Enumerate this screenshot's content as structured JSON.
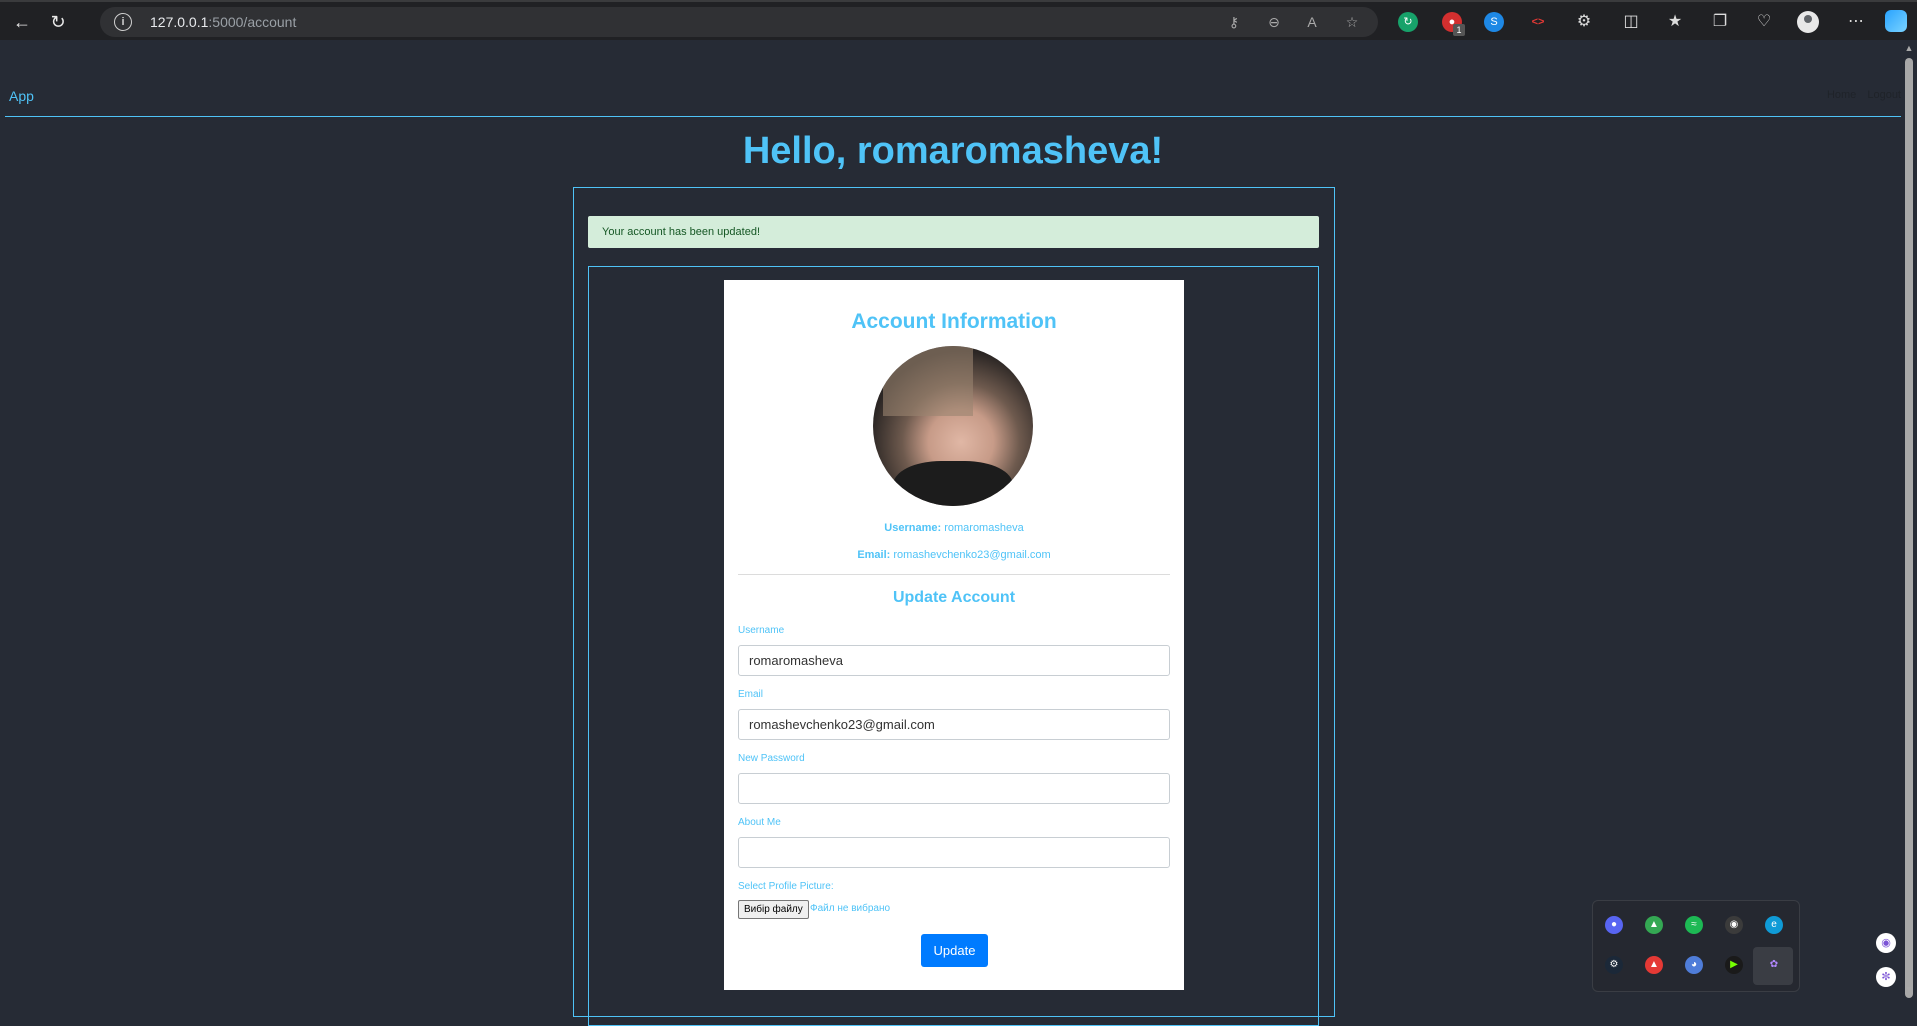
{
  "browser": {
    "url_host": "127.0.0.1",
    "url_path": ":5000/account",
    "badge_count": "1"
  },
  "nav": {
    "brand": "App",
    "links": [
      "Home",
      "Logout"
    ]
  },
  "greeting": "Hello, romaromasheva!",
  "alert": "Your account has been updated!",
  "account": {
    "title": "Account Information",
    "username_label": "Username:",
    "username_value": "romaromasheva",
    "email_label": "Email:",
    "email_value": "romashevchenko23@gmail.com"
  },
  "form": {
    "title": "Update Account",
    "username_label": "Username",
    "username_value": "romaromasheva",
    "email_label": "Email",
    "email_value": "romashevchenko23@gmail.com",
    "password_label": "New Password",
    "password_value": "",
    "about_label": "About Me",
    "about_value": "",
    "picture_label": "Select Profile Picture:",
    "file_button": "Вибір файлу",
    "file_status": "Файл не вибрано",
    "submit": "Update"
  },
  "colors": {
    "accent": "#4fc3f7",
    "background": "#262b35",
    "alert_bg": "#d4edda",
    "button": "#007bff"
  }
}
